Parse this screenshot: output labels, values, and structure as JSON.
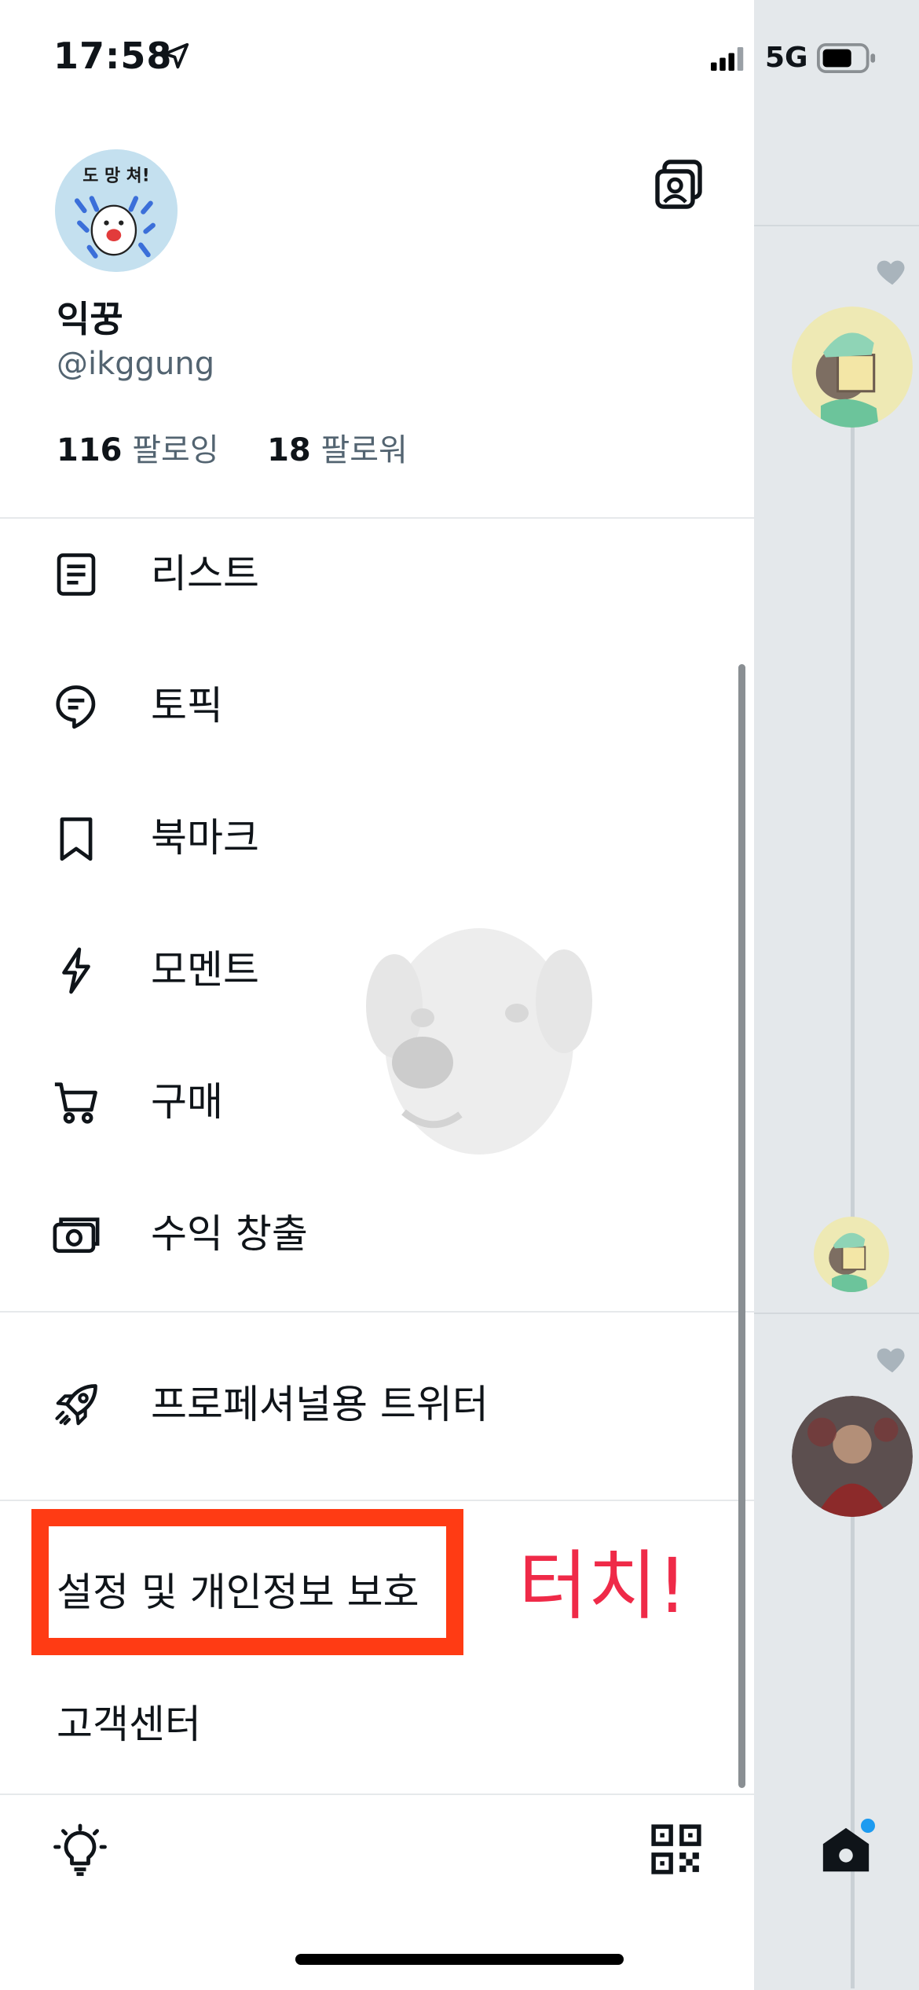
{
  "status_bar": {
    "time": "17:58",
    "network": "5G"
  },
  "profile": {
    "avatar_text": "도 망 쳐!",
    "display_name": "익꿍",
    "handle": "@ikggung",
    "following_count": "116",
    "following_label": "팔로잉",
    "followers_count": "18",
    "followers_label": "팔로워"
  },
  "menu": {
    "items": [
      {
        "label": "리스트",
        "icon": "list-icon"
      },
      {
        "label": "토픽",
        "icon": "topic-icon"
      },
      {
        "label": "북마크",
        "icon": "bookmark-icon"
      },
      {
        "label": "모멘트",
        "icon": "lightning-icon"
      },
      {
        "label": "구매",
        "icon": "cart-icon"
      },
      {
        "label": "수익 창출",
        "icon": "money-icon"
      }
    ],
    "professional": {
      "label": "프로페셔널용 트위터",
      "icon": "rocket-icon"
    },
    "settings": "설정 및 개인정보 보호",
    "help": "고객센터"
  },
  "annotation": "터치!",
  "colors": {
    "highlight": "#ff3b14",
    "annotation": "#ef2a48",
    "notification_dot": "#1d9bf0"
  }
}
